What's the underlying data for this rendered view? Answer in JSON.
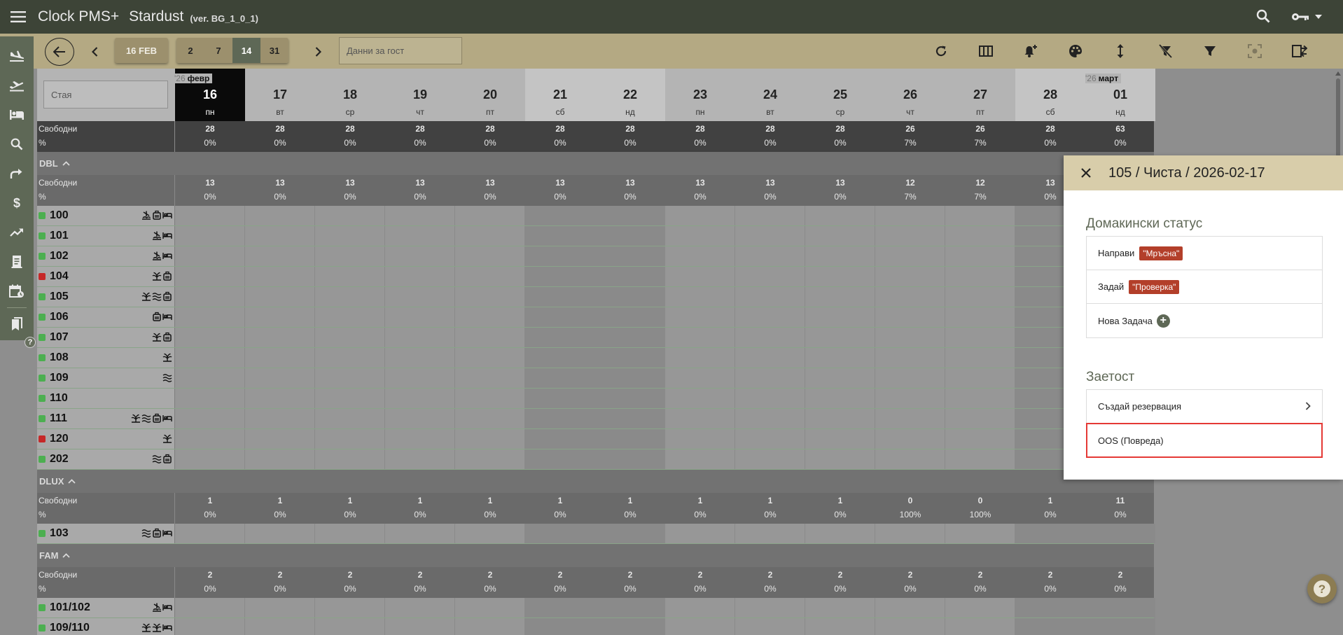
{
  "app": {
    "brand": "Clock PMS+",
    "hotel": "Stardust",
    "version": "(ver. BG_1_0_1)"
  },
  "toolbar": {
    "current_date": "16 FEB",
    "zoom_options": [
      {
        "label": "2"
      },
      {
        "label": "7"
      },
      {
        "label": "14"
      },
      {
        "label": "31"
      }
    ],
    "zoom_selected": "14",
    "guest_search_placeholder": "Данни за гост"
  },
  "grid": {
    "room_search_placeholder": "Стая",
    "months": [
      {
        "year": "'26",
        "name": "февр"
      },
      {
        "year": "'26",
        "name": "март"
      }
    ],
    "days": [
      {
        "num": "16",
        "name": "пн"
      },
      {
        "num": "17",
        "name": "вт"
      },
      {
        "num": "18",
        "name": "ср"
      },
      {
        "num": "19",
        "name": "чт"
      },
      {
        "num": "20",
        "name": "пт"
      },
      {
        "num": "21",
        "name": "сб"
      },
      {
        "num": "22",
        "name": "нд"
      },
      {
        "num": "23",
        "name": "пн"
      },
      {
        "num": "24",
        "name": "вт"
      },
      {
        "num": "25",
        "name": "ср"
      },
      {
        "num": "26",
        "name": "чт"
      },
      {
        "num": "27",
        "name": "пт"
      },
      {
        "num": "28",
        "name": "сб"
      },
      {
        "num": "01",
        "name": "нд"
      }
    ],
    "free_label": "Свободни",
    "pct_label": "%",
    "totals": {
      "free": [
        "28",
        "28",
        "28",
        "28",
        "28",
        "28",
        "28",
        "28",
        "28",
        "28",
        "26",
        "26",
        "28",
        "63"
      ],
      "pct": [
        "0%",
        "0%",
        "0%",
        "0%",
        "0%",
        "0%",
        "0%",
        "0%",
        "0%",
        "0%",
        "7%",
        "7%",
        "0%",
        "0%"
      ]
    },
    "groups": [
      {
        "name": "DBL",
        "free": [
          "13",
          "13",
          "13",
          "13",
          "13",
          "13",
          "13",
          "13",
          "13",
          "13",
          "12",
          "12",
          "13",
          ""
        ],
        "pct": [
          "0%",
          "0%",
          "0%",
          "0%",
          "0%",
          "0%",
          "0%",
          "0%",
          "0%",
          "0%",
          "7%",
          "7%",
          "0%",
          ""
        ],
        "rooms": [
          {
            "num": "100",
            "status": "clean",
            "icons": [
              "beach",
              "luggage",
              "bed"
            ]
          },
          {
            "num": "101",
            "status": "clean",
            "icons": [
              "beach",
              "bed"
            ]
          },
          {
            "num": "102",
            "status": "clean",
            "icons": [
              "beach",
              "bed"
            ]
          },
          {
            "num": "104",
            "status": "dirty",
            "icons": [
              "garden",
              "luggage"
            ]
          },
          {
            "num": "105",
            "status": "clean",
            "icons": [
              "garden",
              "waves",
              "luggage"
            ]
          },
          {
            "num": "106",
            "status": "clean",
            "icons": [
              "luggage",
              "bed"
            ]
          },
          {
            "num": "107",
            "status": "clean",
            "icons": [
              "garden",
              "luggage"
            ]
          },
          {
            "num": "108",
            "status": "clean",
            "icons": [
              "garden"
            ]
          },
          {
            "num": "109",
            "status": "clean",
            "icons": [
              "waves"
            ]
          },
          {
            "num": "110",
            "status": "clean",
            "icons": []
          },
          {
            "num": "111",
            "status": "clean",
            "icons": [
              "garden",
              "waves",
              "luggage",
              "bed"
            ]
          },
          {
            "num": "120",
            "status": "dirty",
            "icons": [
              "garden"
            ]
          },
          {
            "num": "202",
            "status": "clean",
            "icons": [
              "waves",
              "luggage"
            ]
          }
        ]
      },
      {
        "name": "DLUX",
        "free": [
          "1",
          "1",
          "1",
          "1",
          "1",
          "1",
          "1",
          "1",
          "1",
          "1",
          "0",
          "0",
          "1",
          "11"
        ],
        "pct": [
          "0%",
          "0%",
          "0%",
          "0%",
          "0%",
          "0%",
          "0%",
          "0%",
          "0%",
          "0%",
          "100%",
          "100%",
          "0%",
          "0%"
        ],
        "rooms": [
          {
            "num": "103",
            "status": "clean",
            "icons": [
              "waves",
              "luggage",
              "bed"
            ]
          }
        ]
      },
      {
        "name": "FAM",
        "free": [
          "2",
          "2",
          "2",
          "2",
          "2",
          "2",
          "2",
          "2",
          "2",
          "2",
          "2",
          "2",
          "2",
          "2"
        ],
        "pct": [
          "0%",
          "0%",
          "0%",
          "0%",
          "0%",
          "0%",
          "0%",
          "0%",
          "0%",
          "0%",
          "0%",
          "0%",
          "0%",
          "0%"
        ],
        "rooms": [
          {
            "num": "101/102",
            "status": "clean",
            "icons": [
              "beach",
              "bed"
            ]
          },
          {
            "num": "109/110",
            "status": "clean",
            "icons": [
              "garden",
              "garden",
              "bed"
            ]
          }
        ]
      }
    ]
  },
  "panel": {
    "title": "105 / Чиста / 2026-02-17",
    "housekeeping_title": "Домакински статус",
    "make_label": "Направи",
    "make_badge": "\"Мръсна\"",
    "set_label": "Задай",
    "set_badge": "\"Проверка\"",
    "new_task_label": "Нова Задача",
    "occupancy_title": "Заетост",
    "create_reservation_label": "Създай резервация",
    "oos_label": "OOS (Повреда)"
  },
  "colors": {
    "clean": "#4caf50",
    "dirty": "#c62828",
    "accent": "#5e6856",
    "topbar": "#3d4437",
    "toolbar": "#b4a983",
    "badge": "#b33f2a"
  }
}
